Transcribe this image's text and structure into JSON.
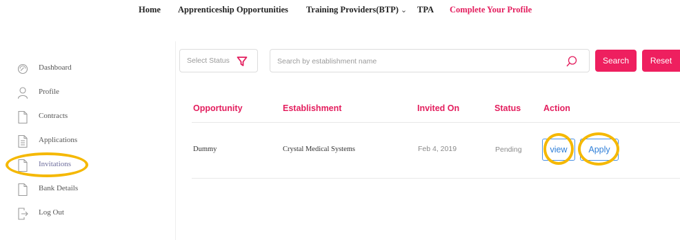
{
  "nav": {
    "home": "Home",
    "apprenticeship": "Apprenticeship Opportunities",
    "training_providers": "Training Providers(BTP)",
    "tpa": "TPA",
    "complete_profile": "Complete Your Profile"
  },
  "sidebar": {
    "items": [
      {
        "label": "Dashboard",
        "icon": "dashboard-gauge-icon"
      },
      {
        "label": "Profile",
        "icon": "user-icon"
      },
      {
        "label": "Contracts",
        "icon": "document-icon"
      },
      {
        "label": "Applications",
        "icon": "document-lines-icon"
      },
      {
        "label": "Invitations",
        "icon": "document-icon"
      },
      {
        "label": "Bank Details",
        "icon": "document-icon"
      },
      {
        "label": "Log Out",
        "icon": "logout-icon"
      }
    ],
    "active": "Invitations"
  },
  "filters": {
    "status_placeholder": "Select Status",
    "search_placeholder": "Search by establishment name",
    "search_button": "Search",
    "reset_button": "Reset"
  },
  "table": {
    "columns": [
      "Opportunity",
      "Establishment",
      "Invited On",
      "Status",
      "Action"
    ],
    "rows": [
      {
        "opportunity": "Dummy",
        "establishment": "Crystal Medical Systems",
        "invited_on": "Feb 4, 2019",
        "status": "Pending",
        "actions": [
          "view",
          "Apply"
        ]
      }
    ]
  },
  "colors": {
    "accent": "#e31d5d",
    "button": "#ee1f5f",
    "link_blue": "#2f7fd8",
    "highlight": "#f5b800"
  }
}
